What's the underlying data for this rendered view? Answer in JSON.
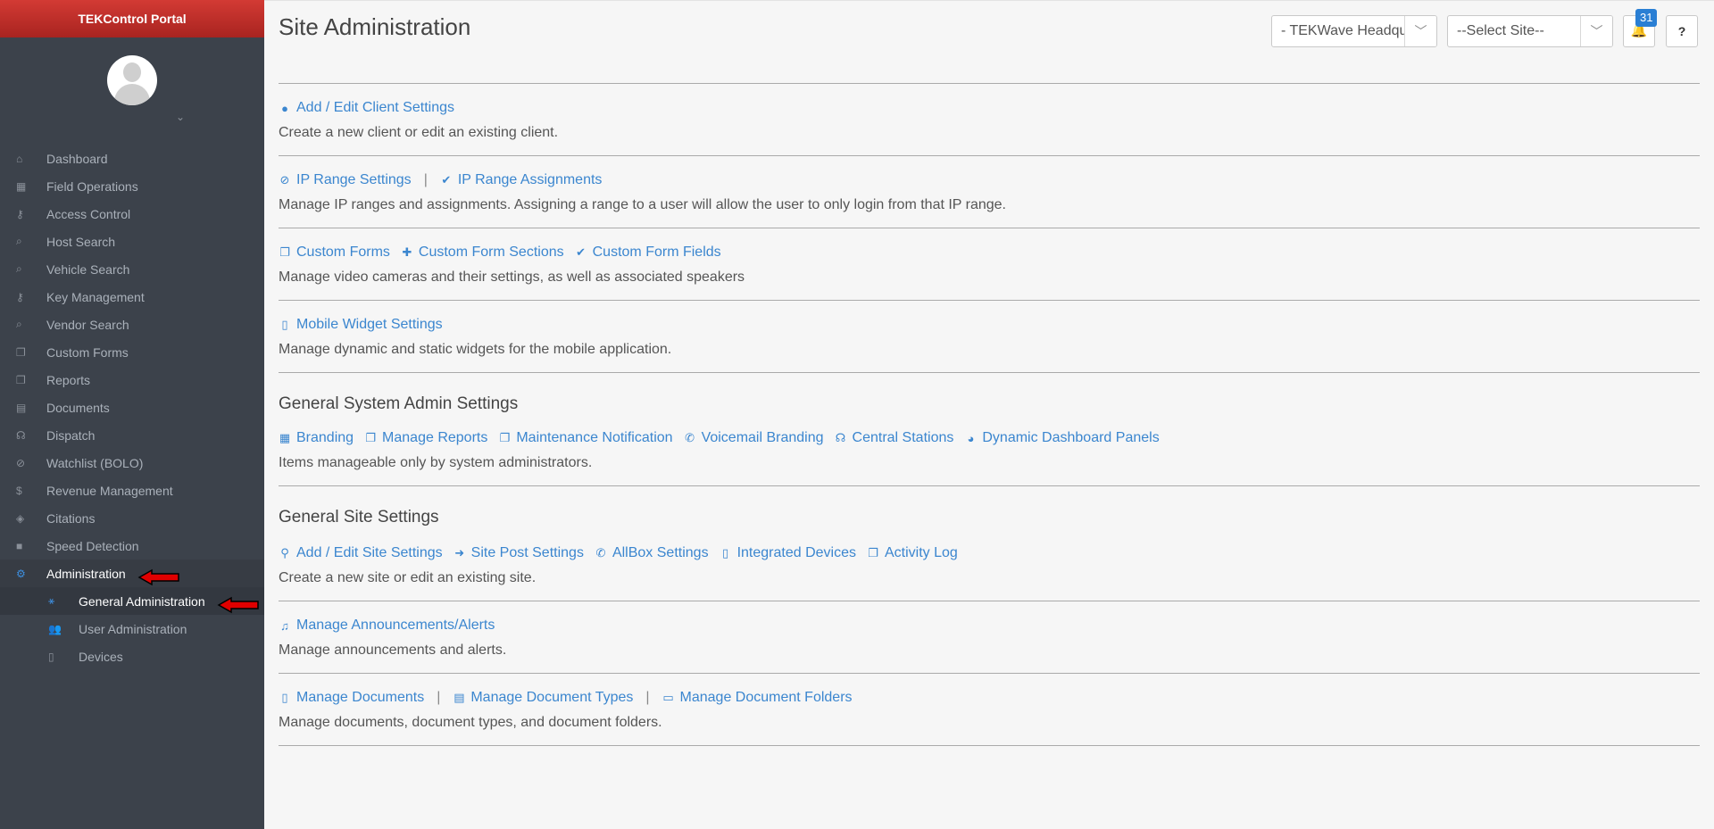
{
  "sidebar": {
    "brand": "TEKControl Portal",
    "items": [
      {
        "label": "Dashboard",
        "icon": "home-icon",
        "glyph": "⌂"
      },
      {
        "label": "Field Operations",
        "icon": "table-icon",
        "glyph": "▦"
      },
      {
        "label": "Access Control",
        "icon": "key-icon",
        "glyph": "⚷"
      },
      {
        "label": "Host Search",
        "icon": "search-icon",
        "glyph": "⌕"
      },
      {
        "label": "Vehicle Search",
        "icon": "search-icon",
        "glyph": "⌕"
      },
      {
        "label": "Key Management",
        "icon": "key-icon",
        "glyph": "⚷"
      },
      {
        "label": "Vendor Search",
        "icon": "search-icon",
        "glyph": "⌕"
      },
      {
        "label": "Custom Forms",
        "icon": "copy-icon",
        "glyph": "❐"
      },
      {
        "label": "Reports",
        "icon": "copy-icon",
        "glyph": "❐"
      },
      {
        "label": "Documents",
        "icon": "file-icon",
        "glyph": "▤"
      },
      {
        "label": "Dispatch",
        "icon": "headset-icon",
        "glyph": "☊"
      },
      {
        "label": "Watchlist (BOLO)",
        "icon": "ban-icon",
        "glyph": "⊘"
      },
      {
        "label": "Revenue Management",
        "icon": "dollar-icon",
        "glyph": "$"
      },
      {
        "label": "Citations",
        "icon": "ticket-icon",
        "glyph": "◈"
      },
      {
        "label": "Speed Detection",
        "icon": "camera-icon",
        "glyph": "■"
      },
      {
        "label": "Administration",
        "icon": "cogs-icon",
        "glyph": "⚙"
      }
    ],
    "subitems": [
      {
        "label": "General Administration",
        "icon": "sitemap-icon",
        "glyph": "⚹"
      },
      {
        "label": "User Administration",
        "icon": "users-icon",
        "glyph": "👥"
      },
      {
        "label": "Devices",
        "icon": "mobile-icon",
        "glyph": "▯"
      }
    ]
  },
  "header": {
    "title": "Site Administration",
    "client_select": "- TEKWave Headqu",
    "site_select": "--Select Site--",
    "notifications_count": "31",
    "help_label": "?"
  },
  "sections": {
    "client": {
      "links": [
        "Add / Edit Client Settings"
      ],
      "desc": "Create a new client or edit an existing client."
    },
    "ip": {
      "links": [
        "IP Range Settings",
        "IP Range Assignments"
      ],
      "separator": "|",
      "desc": "Manage IP ranges and assignments. Assigning a range to a user will allow the user to only login from that IP range."
    },
    "forms": {
      "links": [
        "Custom Forms",
        "Custom Form Sections",
        "Custom Form Fields"
      ],
      "desc": "Manage video cameras and their settings, as well as associated speakers"
    },
    "mobile": {
      "links": [
        "Mobile Widget Settings"
      ],
      "desc": "Manage dynamic and static widgets for the mobile application."
    },
    "system": {
      "title": "General System Admin Settings",
      "links": [
        "Branding",
        "Manage Reports",
        "Maintenance Notification",
        "Voicemail Branding",
        "Central Stations",
        "Dynamic Dashboard Panels"
      ],
      "desc": "Items manageable only by system administrators."
    },
    "site": {
      "title": "General Site Settings",
      "links": [
        "Add / Edit Site Settings",
        "Site Post Settings",
        "AllBox Settings",
        "Integrated Devices",
        "Activity Log"
      ],
      "desc": "Create a new site or edit an existing site."
    },
    "announcements": {
      "links": [
        "Manage Announcements/Alerts"
      ],
      "desc": "Manage announcements and alerts."
    },
    "documents": {
      "links": [
        "Manage Documents",
        "Manage Document Types",
        "Manage Document Folders"
      ],
      "separator": "|",
      "desc": "Manage documents, document types, and document folders."
    }
  }
}
